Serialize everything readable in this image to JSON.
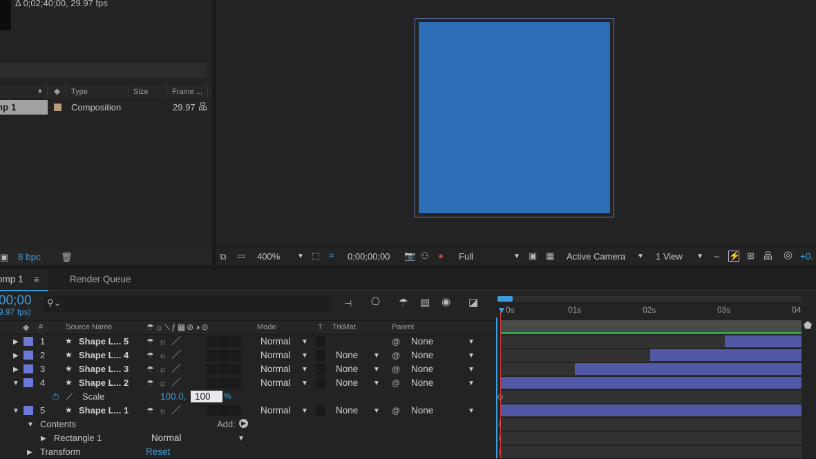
{
  "project": {
    "info_text": "Δ 0;02;40;00, 29.97 fps",
    "columns": {
      "type": "Type",
      "size": "Size",
      "frame": "Frame ..."
    },
    "item": {
      "name": "mp 1",
      "type": "Composition",
      "frame_rate": "29.97"
    },
    "bpc": "8 bpc"
  },
  "viewer": {
    "zoom": "400%",
    "timecode": "0;00;00;00",
    "resolution": "Full",
    "camera": "Active Camera",
    "views": "1 View",
    "exposure": "+0.",
    "solid_color": "#2d6db6"
  },
  "timeline": {
    "tabs": {
      "comp": "omp 1",
      "comp_menu": "≡",
      "render_queue": "Render Queue"
    },
    "current_time": "00;00",
    "fps": "9.97 fps)",
    "columns": {
      "num": "#",
      "source": "Source Name",
      "mode": "Mode",
      "t": "T",
      "trkmat": "TrkMat",
      "parent": "Parent"
    },
    "ruler": [
      "0s",
      "01s",
      "02s",
      "03s",
      "04"
    ],
    "layers": [
      {
        "num": "1",
        "name": "Shape L... 5",
        "mode": "Normal",
        "trkmat": "",
        "parent": "None",
        "bar_start": 0.75
      },
      {
        "num": "2",
        "name": "Shape L... 4",
        "mode": "Normal",
        "trkmat": "None",
        "parent": "None",
        "bar_start": 0.5
      },
      {
        "num": "3",
        "name": "Shape L... 3",
        "mode": "Normal",
        "trkmat": "None",
        "parent": "None",
        "bar_start": 0.25
      },
      {
        "num": "4",
        "name": "Shape L... 2",
        "mode": "Normal",
        "trkmat": "None",
        "parent": "None",
        "bar_start": 0
      },
      {
        "num": "5",
        "name": "Shape L... 1",
        "mode": "Normal",
        "trkmat": "None",
        "parent": "None",
        "bar_start": 0
      }
    ],
    "scale": {
      "label": "Scale",
      "x": "100.0,",
      "y": "100",
      "unit": "%"
    },
    "contents": {
      "label": "Contents",
      "add": "Add:"
    },
    "rectangle": {
      "label": "Rectangle 1",
      "mode": "Normal"
    },
    "transform": {
      "label": "Transform",
      "reset": "Reset"
    }
  }
}
